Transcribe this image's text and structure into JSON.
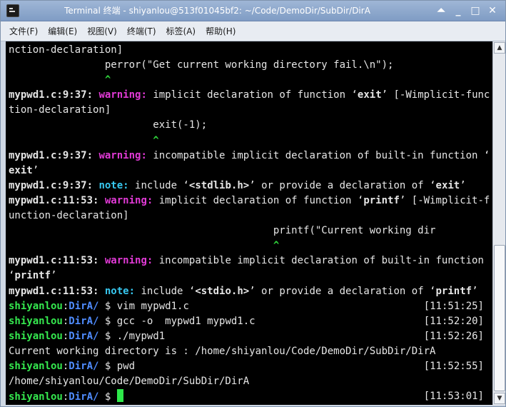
{
  "window": {
    "title": "Terminal 终端 - shiyanlou@513f01045bf2: ~/Code/DemoDir/SubDir/DirA",
    "controls": {
      "shade": "⏶",
      "minimize": "_",
      "maximize": "□",
      "close": "✕"
    }
  },
  "menubar": {
    "items": [
      "文件(F)",
      "编辑(E)",
      "视图(V)",
      "终端(T)",
      "标签(A)",
      "帮助(H)"
    ]
  },
  "terminal": {
    "lines": [
      {
        "text": "nction-declaration]"
      },
      {
        "text": "                perror(\"Get current working directory fail.\\n\");"
      },
      {
        "caret": "                ^"
      },
      {
        "file": "mypwd1.c:9:37:",
        "sev": "warning:",
        "sev_type": "warn",
        "pre": " implicit declaration of function ",
        "q1": "‘",
        "qb": "exit",
        "q2": "’",
        "post": " [-Wimplicit-func"
      },
      {
        "text": "tion-declaration]"
      },
      {
        "text": "                        exit(-1);"
      },
      {
        "caret": "                        ^"
      },
      {
        "file": "mypwd1.c:9:37:",
        "sev": "warning:",
        "sev_type": "warn",
        "pre": " incompatible implicit declaration of built-in function ",
        "q1": "‘",
        "qb": "",
        "q2": "",
        "post": ""
      },
      {
        "boldtext": "exit",
        "text": "’"
      },
      {
        "file": "mypwd1.c:9:37:",
        "sev": "note:",
        "sev_type": "note",
        "pre": " include ",
        "q1": "‘",
        "qb": "<stdlib.h>",
        "q2": "’",
        "post": " or provide a declaration of ‘",
        "tailbold": "exit",
        "tail": "’"
      },
      {
        "file": "mypwd1.c:11:53:",
        "sev": "warning:",
        "sev_type": "warn",
        "pre": " implicit declaration of function ",
        "q1": "‘",
        "qb": "printf",
        "q2": "’",
        "post": " [-Wimplicit-f"
      },
      {
        "text": "unction-declaration]"
      },
      {
        "text": "                                            printf(\"Current working dir"
      },
      {
        "caret": "                                            ^"
      },
      {
        "file": "mypwd1.c:11:53:",
        "sev": "warning:",
        "sev_type": "warn",
        "pre": " incompatible implicit declaration of built-in function",
        "q1": "",
        "qb": "",
        "q2": "",
        "post": ""
      },
      {
        "text": "‘",
        "boldtext2": "printf",
        "text2": "’"
      },
      {
        "file": "mypwd1.c:11:53:",
        "sev": "note:",
        "sev_type": "note",
        "pre": " include ",
        "q1": "‘",
        "qb": "<stdio.h>",
        "q2": "’",
        "post": " or provide a declaration of ‘",
        "tailbold": "printf",
        "tail": "’"
      },
      {
        "prompt_user": "shiyanlou",
        "prompt_dir": "DirA/",
        "cmd": " $ vim mypwd1.c",
        "time": "[11:51:25]"
      },
      {
        "prompt_user": "shiyanlou",
        "prompt_dir": "DirA/",
        "cmd": " $ gcc -o  mypwd1 mypwd1.c",
        "time": "[11:52:20]"
      },
      {
        "prompt_user": "shiyanlou",
        "prompt_dir": "DirA/",
        "cmd": " $ ./mypwd1",
        "time": "[11:52:26]"
      },
      {
        "text": "Current working directory is : /home/shiyanlou/Code/DemoDir/SubDir/DirA"
      },
      {
        "prompt_user": "shiyanlou",
        "prompt_dir": "DirA/",
        "cmd": " $ pwd",
        "time": "[11:52:55]"
      },
      {
        "text": "/home/shiyanlou/Code/DemoDir/SubDir/DirA"
      },
      {
        "prompt_user": "shiyanlou",
        "prompt_dir": "DirA/",
        "cmd": " $ ",
        "time": "[11:53:01]",
        "cursor": true
      }
    ]
  },
  "colors": {
    "terminal_bg": "#000000",
    "warning": "#e13ad6",
    "note": "#37c8f0",
    "prompt_user": "#35e84f",
    "prompt_dir": "#4f8cff",
    "cursor": "#2ee84a",
    "titlebar": "#8ba7cf"
  },
  "icons": {
    "app": "terminal-icon",
    "scroll_up": "arrow-up-icon",
    "scroll_down": "arrow-down-icon"
  }
}
